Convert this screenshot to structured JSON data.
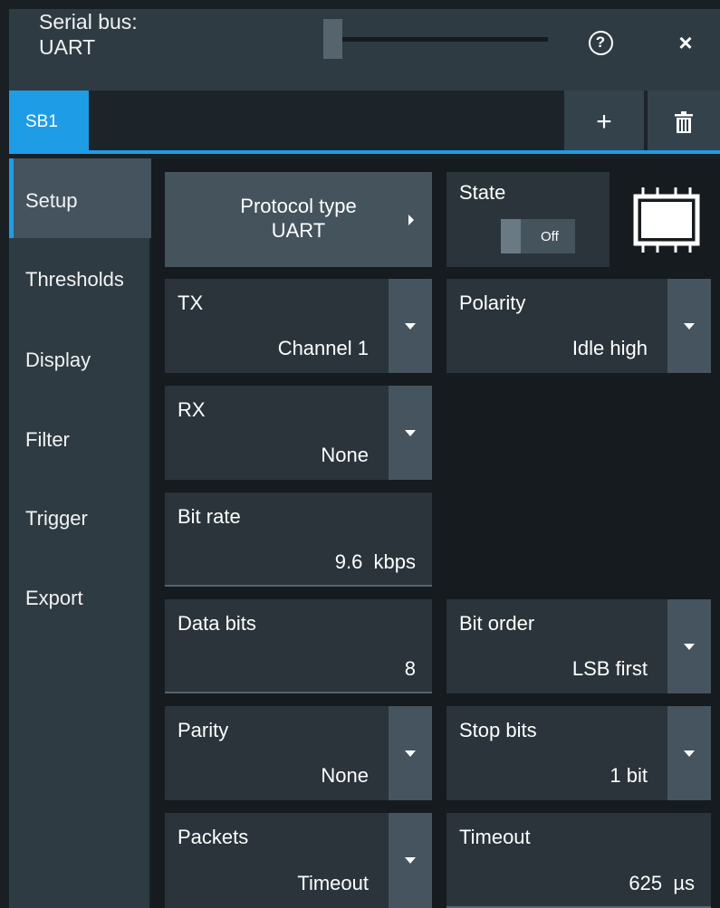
{
  "window": {
    "title_line1": "Serial bus:",
    "title_line2": "UART",
    "help_label": "?",
    "close_label": "×"
  },
  "tabs": [
    {
      "label": "SB1",
      "active": true
    }
  ],
  "tab_actions": {
    "add_label": "+"
  },
  "nav": {
    "items": [
      {
        "label": "Setup",
        "active": true
      },
      {
        "label": "Thresholds"
      },
      {
        "label": "Display"
      },
      {
        "label": "Filter"
      },
      {
        "label": "Trigger"
      },
      {
        "label": "Export"
      }
    ]
  },
  "setup": {
    "protocol_type": {
      "label": "Protocol type",
      "value": "UART"
    },
    "state": {
      "label": "State",
      "value": "Off"
    },
    "tx": {
      "label": "TX",
      "value": "Channel 1"
    },
    "polarity": {
      "label": "Polarity",
      "value": "Idle high"
    },
    "rx": {
      "label": "RX",
      "value": "None"
    },
    "bit_rate": {
      "label": "Bit rate",
      "value": "9.6  kbps"
    },
    "data_bits": {
      "label": "Data bits",
      "value": "8"
    },
    "bit_order": {
      "label": "Bit order",
      "value": "LSB first"
    },
    "parity": {
      "label": "Parity",
      "value": "None"
    },
    "stop_bits": {
      "label": "Stop bits",
      "value": "1 bit"
    },
    "packets": {
      "label": "Packets",
      "value": "Timeout"
    },
    "timeout": {
      "label": "Timeout",
      "value": "625  µs"
    }
  },
  "colors": {
    "accent": "#1f9ce6",
    "panel": "#2a343a",
    "background": "#151b1f"
  },
  "icons": [
    "help-icon",
    "close-icon",
    "plus-icon",
    "trash-icon",
    "caret-right-icon",
    "dropdown-caret-icon",
    "chip-icon"
  ]
}
